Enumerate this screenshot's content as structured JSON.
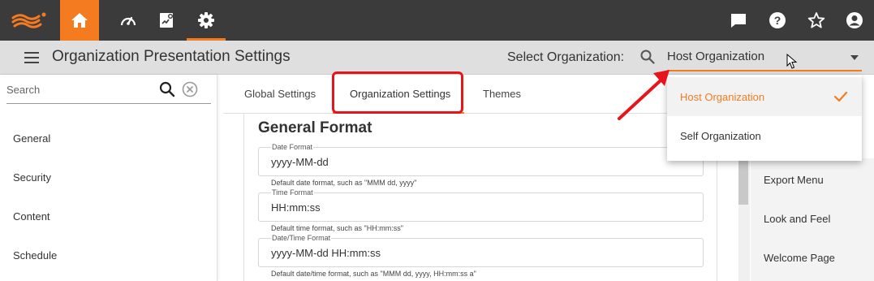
{
  "nav": {
    "logo": "logi-logo",
    "items": [
      "home-icon",
      "performance-icon",
      "report-icon",
      "settings-icon"
    ],
    "right_icons": [
      "chat-icon",
      "help-icon",
      "star-icon",
      "account-icon"
    ]
  },
  "header": {
    "title": "Organization Presentation Settings",
    "select_label": "Select Organization:",
    "selected_org": "Host Organization"
  },
  "sidebar": {
    "search_placeholder": "Search",
    "items": [
      {
        "label": "General"
      },
      {
        "label": "Security"
      },
      {
        "label": "Content"
      },
      {
        "label": "Schedule"
      }
    ]
  },
  "tabs": [
    {
      "label": "Global Settings"
    },
    {
      "label": "Organization Settings"
    },
    {
      "label": "Themes"
    }
  ],
  "main": {
    "section_title": "General Format",
    "fields": [
      {
        "label": "Date Format",
        "value": "yyyy-MM-dd",
        "hint": "Default date format, such as \"MMM dd, yyyy\""
      },
      {
        "label": "Time Format",
        "value": "HH:mm:ss",
        "hint": "Default time format, such as \"HH:mm:ss\""
      },
      {
        "label": "Date/Time Format",
        "value": "yyyy-MM-dd HH:mm:ss",
        "hint": "Default date/time format, such as \"MMM dd, yyyy, HH:mm:ss a\""
      }
    ]
  },
  "right_panel": {
    "items": [
      {
        "label": "Export Menu"
      },
      {
        "label": "Look and Feel"
      },
      {
        "label": "Welcome Page"
      }
    ]
  },
  "dropdown": {
    "options": [
      {
        "label": "Host Organization",
        "selected": true
      },
      {
        "label": "Self Organization",
        "selected": false
      }
    ]
  },
  "colors": {
    "accent": "#f47b20",
    "topbar": "#3b3b3b",
    "annotation": "#e8141c"
  }
}
